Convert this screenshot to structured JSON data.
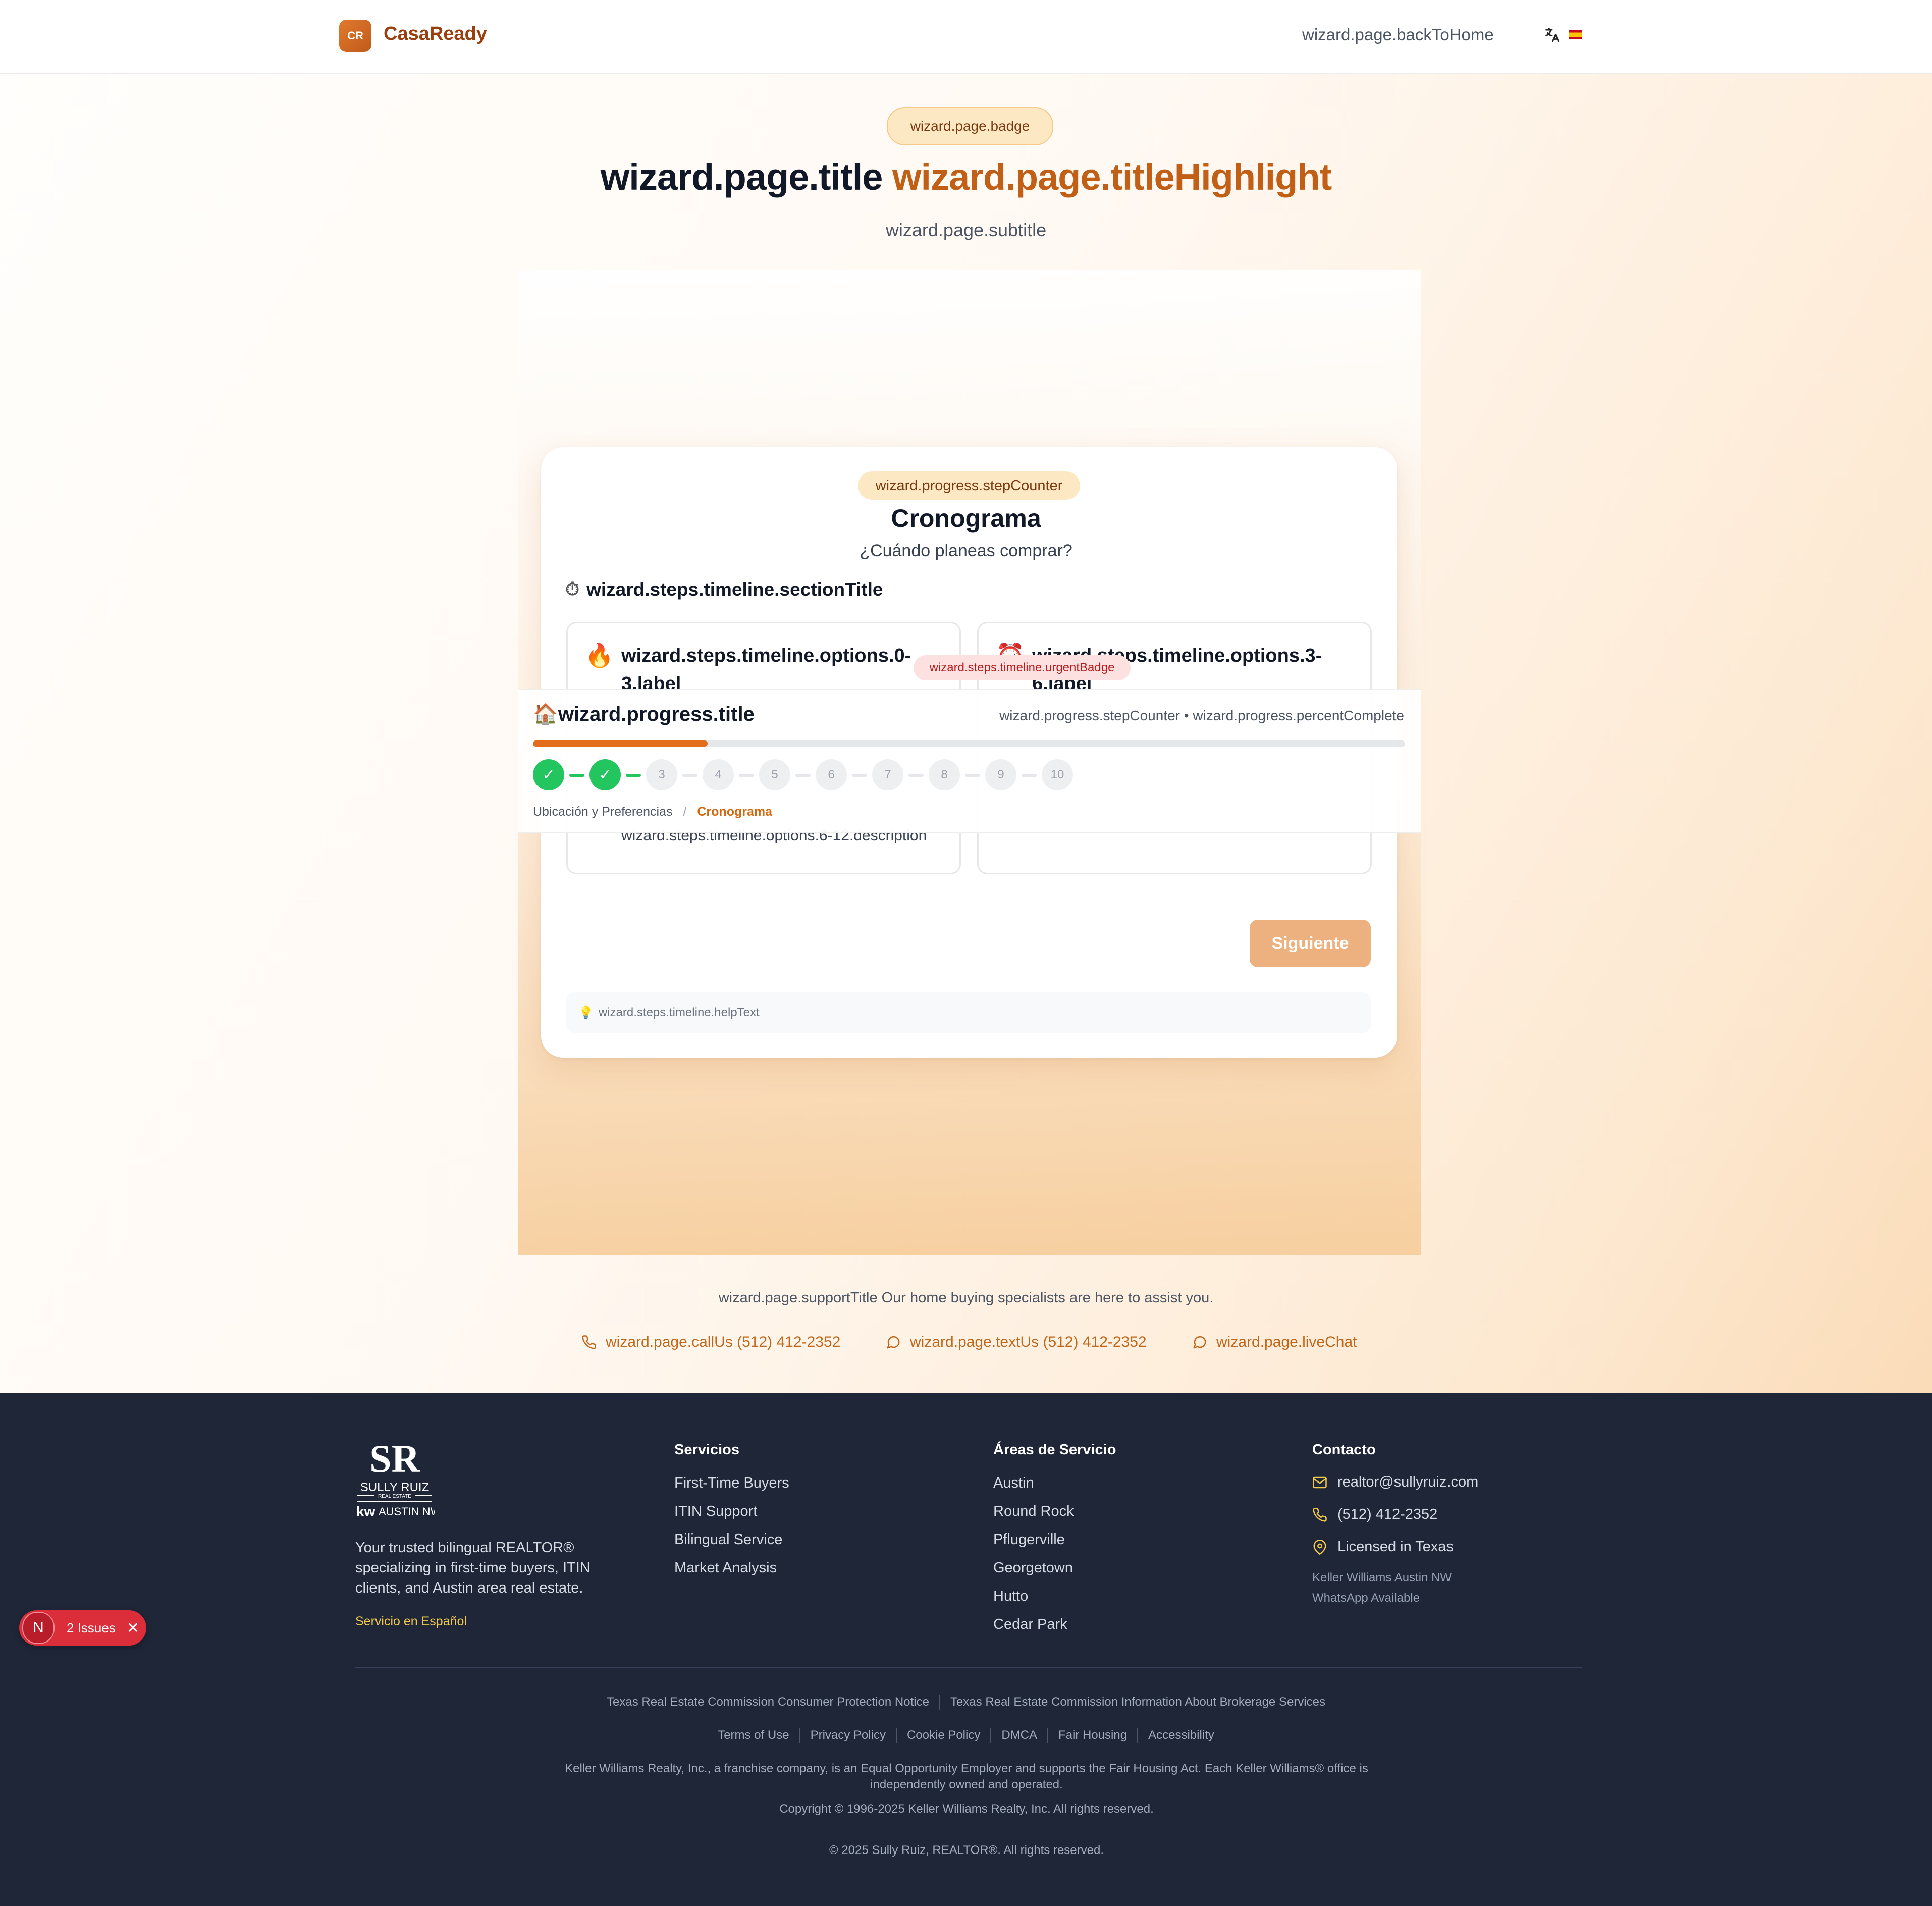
{
  "header": {
    "logo_initials": "CR",
    "brand": "CasaReady",
    "back_to_home": "wizard.page.backToHome",
    "language_flag": "flag-spain-icon"
  },
  "hero": {
    "badge": "wizard.page.badge",
    "title": "wizard.page.title",
    "title_highlight": "wizard.page.titleHighlight",
    "subtitle": "wizard.page.subtitle"
  },
  "wizard": {
    "step_counter": "wizard.progress.stepCounter",
    "title": "Cronograma",
    "question": "¿Cuándo planeas comprar?",
    "section_title": "wizard.steps.timeline.sectionTitle",
    "options": [
      {
        "emoji": "🔥",
        "label": "wizard.steps.timeline.options.0-3.label"
      },
      {
        "emoji": "⏰",
        "label": "wizard.steps.timeline.options.3-6.label"
      }
    ],
    "urgent_badge": "wizard.steps.timeline.urgentBadge",
    "visible_description": "wizard.steps.timeline.options.6-12.description",
    "next_button": "Siguiente",
    "help_text": "wizard.steps.timeline.helpText"
  },
  "progress": {
    "icon": "🏠",
    "title": "wizard.progress.title",
    "meta": "wizard.progress.stepCounter • wizard.progress.percentComplete",
    "fraction_complete": 0.2,
    "steps": [
      "✓",
      "✓",
      "3",
      "4",
      "5",
      "6",
      "7",
      "8",
      "9",
      "10"
    ],
    "completed_steps": 2,
    "breadcrumb_prev": "Ubicación y Preferencias",
    "breadcrumb_sep": "/",
    "breadcrumb_current": "Cronograma"
  },
  "support": {
    "text": "wizard.page.supportTitle Our home buying specialists are here to assist you.",
    "call": "wizard.page.callUs (512) 412-2352",
    "text_us": "wizard.page.textUs (512) 412-2352",
    "live_chat": "wizard.page.liveChat"
  },
  "footer": {
    "logo_text": "SULLY RUIZ",
    "logo_sub": "REAL ESTATE",
    "logo_kw": "AUSTIN NW",
    "tagline": "Your trusted bilingual REALTOR® specializing in first-time buyers, ITIN clients, and Austin area real estate.",
    "spanish": "Servicio en Español",
    "services_title": "Servicios",
    "services": [
      "First-Time Buyers",
      "ITIN Support",
      "Bilingual Service",
      "Market Analysis"
    ],
    "areas_title": "Áreas de Servicio",
    "areas": [
      "Austin",
      "Round Rock",
      "Pflugerville",
      "Georgetown",
      "Hutto",
      "Cedar Park"
    ],
    "contact_title": "Contacto",
    "email": "realtor@sullyruiz.com",
    "phone": "(512) 412-2352",
    "license": "Licensed in Texas",
    "office": "Keller Williams Austin NW",
    "whatsapp": "WhatsApp Available",
    "trec": [
      "Texas Real Estate Commission Consumer Protection Notice",
      "Texas Real Estate Commission Information About Brokerage Services"
    ],
    "legal_links": [
      "Terms of Use",
      "Privacy Policy",
      "Cookie Policy",
      "DMCA",
      "Fair Housing",
      "Accessibility"
    ],
    "kw_notice": "Keller Williams Realty, Inc., a franchise company, is an Equal Opportunity Employer and supports the Fair Housing Act. Each Keller Williams® office is independently owned and operated.",
    "kw_copyright": "Copyright © 1996-2025 Keller Williams Realty, Inc. All rights reserved.",
    "copyright": "© 2025 Sully Ruiz, REALTOR®. All rights reserved."
  },
  "dev_overlay": {
    "letter": "N",
    "issues": "2 Issues"
  },
  "colors": {
    "accent": "#c25f17",
    "progress_fill": "#e26d1c",
    "step_done": "#22c55e",
    "footer_bg": "#1e2638"
  }
}
